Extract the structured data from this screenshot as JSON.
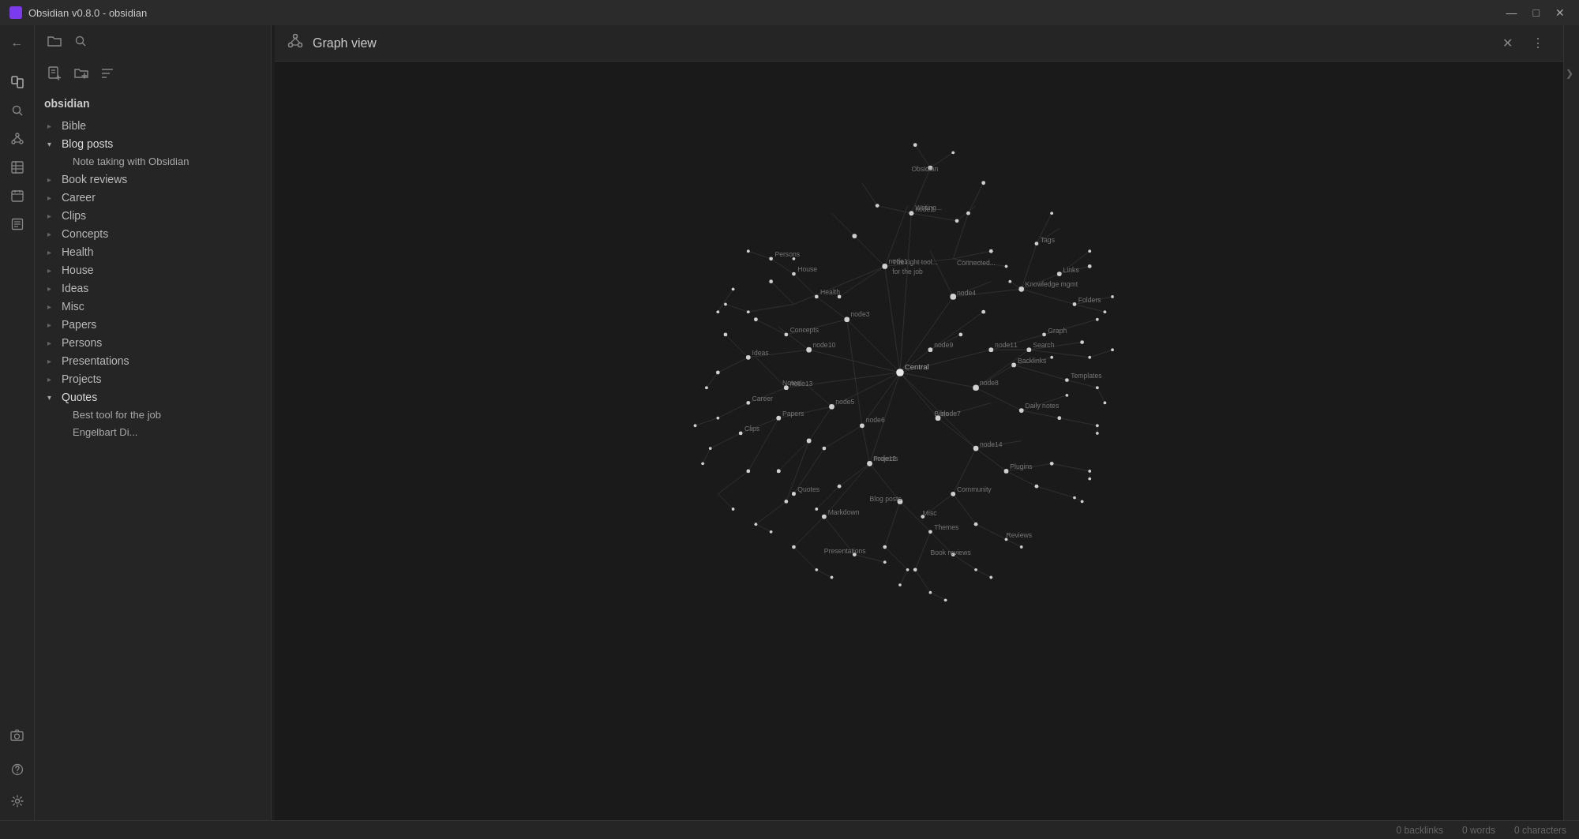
{
  "titlebar": {
    "title": "Obsidian v0.8.0 - obsidian",
    "controls": [
      "minimize",
      "maximize",
      "close"
    ]
  },
  "sidebar_toolbar": {
    "folder_icon": "📁",
    "search_icon": "🔍"
  },
  "file_actions": {
    "new_file_label": "New file",
    "new_folder_label": "New folder",
    "sort_label": "Sort"
  },
  "vault_name": "obsidian",
  "tree": [
    {
      "id": "bible",
      "label": "Bible",
      "expanded": false,
      "children": []
    },
    {
      "id": "blog-posts",
      "label": "Blog posts",
      "expanded": true,
      "children": [
        {
          "id": "note-taking",
          "label": "Note taking with Obsidian"
        }
      ]
    },
    {
      "id": "book-reviews",
      "label": "Book reviews",
      "expanded": false,
      "children": []
    },
    {
      "id": "career",
      "label": "Career",
      "expanded": false,
      "children": []
    },
    {
      "id": "clips",
      "label": "Clips",
      "expanded": false,
      "children": []
    },
    {
      "id": "concepts",
      "label": "Concepts",
      "expanded": false,
      "children": []
    },
    {
      "id": "health",
      "label": "Health",
      "expanded": false,
      "children": []
    },
    {
      "id": "house",
      "label": "House",
      "expanded": false,
      "children": []
    },
    {
      "id": "ideas",
      "label": "Ideas",
      "expanded": false,
      "children": []
    },
    {
      "id": "misc",
      "label": "Misc",
      "expanded": false,
      "children": []
    },
    {
      "id": "papers",
      "label": "Papers",
      "expanded": false,
      "children": []
    },
    {
      "id": "persons",
      "label": "Persons",
      "expanded": false,
      "children": []
    },
    {
      "id": "presentations",
      "label": "Presentations",
      "expanded": false,
      "children": []
    },
    {
      "id": "projects",
      "label": "Projects",
      "expanded": false,
      "children": []
    },
    {
      "id": "quotes",
      "label": "Quotes",
      "expanded": true,
      "children": [
        {
          "id": "best-tool",
          "label": "Best tool for the job"
        },
        {
          "id": "engelbart-di",
          "label": "Engelbart Di..."
        }
      ]
    }
  ],
  "graph_view": {
    "title": "Graph view",
    "icon": "⬡"
  },
  "statusbar": {
    "backlinks": "0 backlinks",
    "words": "0 words",
    "characters": "0 characters"
  },
  "rail_icons": {
    "files": "📄",
    "search": "🔍",
    "graph": "⬡",
    "table": "⊞",
    "daily": "📋",
    "templates": "📑",
    "camera": "📷",
    "help": "?",
    "settings": "⚙"
  }
}
